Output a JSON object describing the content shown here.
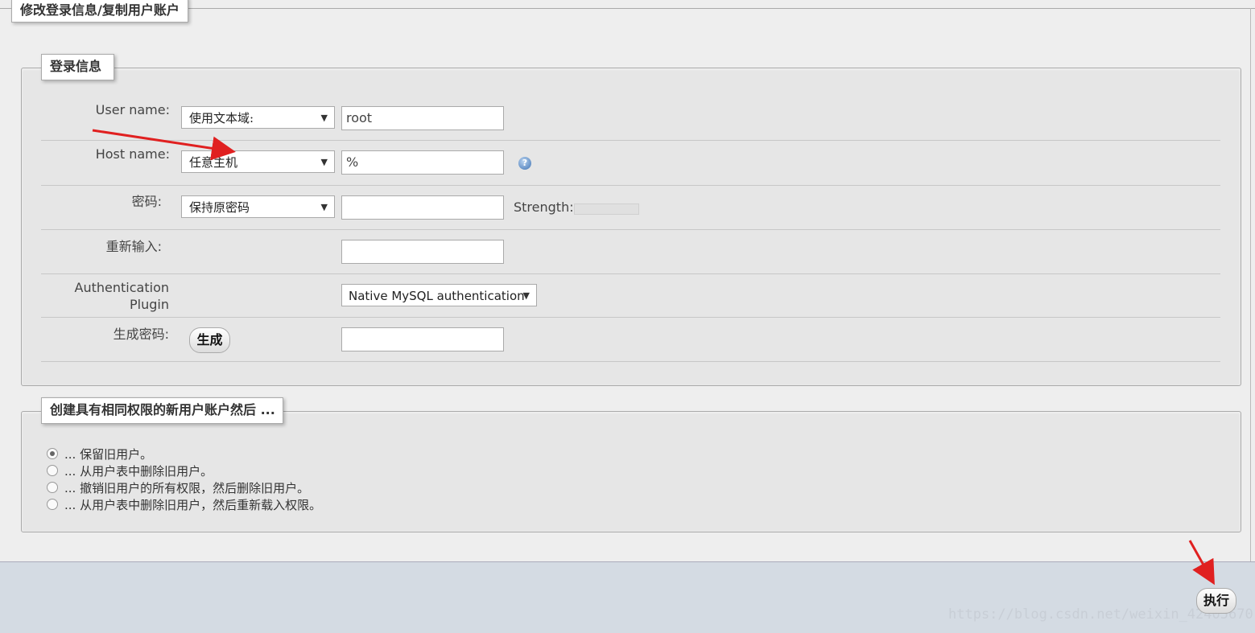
{
  "top_legend": "修改登录信息/复制用户账户",
  "login_section": {
    "legend": "登录信息",
    "username": {
      "label": "User name:",
      "select": "使用文本域:",
      "value": "root"
    },
    "hostname": {
      "label": "Host name:",
      "select": "任意主机",
      "value": "%"
    },
    "password": {
      "label": "密码:",
      "select": "保持原密码",
      "value": "",
      "strength_label": "Strength:"
    },
    "retype": {
      "label": "重新输入:",
      "value": ""
    },
    "auth": {
      "label_line1": "Authentication",
      "label_line2": "Plugin",
      "select": "Native MySQL authentication"
    },
    "generate": {
      "label": "生成密码:",
      "button": "生成",
      "value": ""
    }
  },
  "copy_section": {
    "legend": "创建具有相同权限的新用户账户然后 ...",
    "options": [
      {
        "label": "... 保留旧用户。",
        "checked": true
      },
      {
        "label": "... 从用户表中删除旧用户。",
        "checked": false
      },
      {
        "label": "... 撤销旧用户的所有权限，然后删除旧用户。",
        "checked": false
      },
      {
        "label": "... 从用户表中删除旧用户，然后重新载入权限。",
        "checked": false
      }
    ]
  },
  "footer": {
    "execute_button": "执行",
    "watermark": "https://blog.csdn.net/weixin_42405670"
  },
  "colors": {
    "annotation_arrow": "#e02020",
    "footer_bg": "#d4dbe3"
  }
}
